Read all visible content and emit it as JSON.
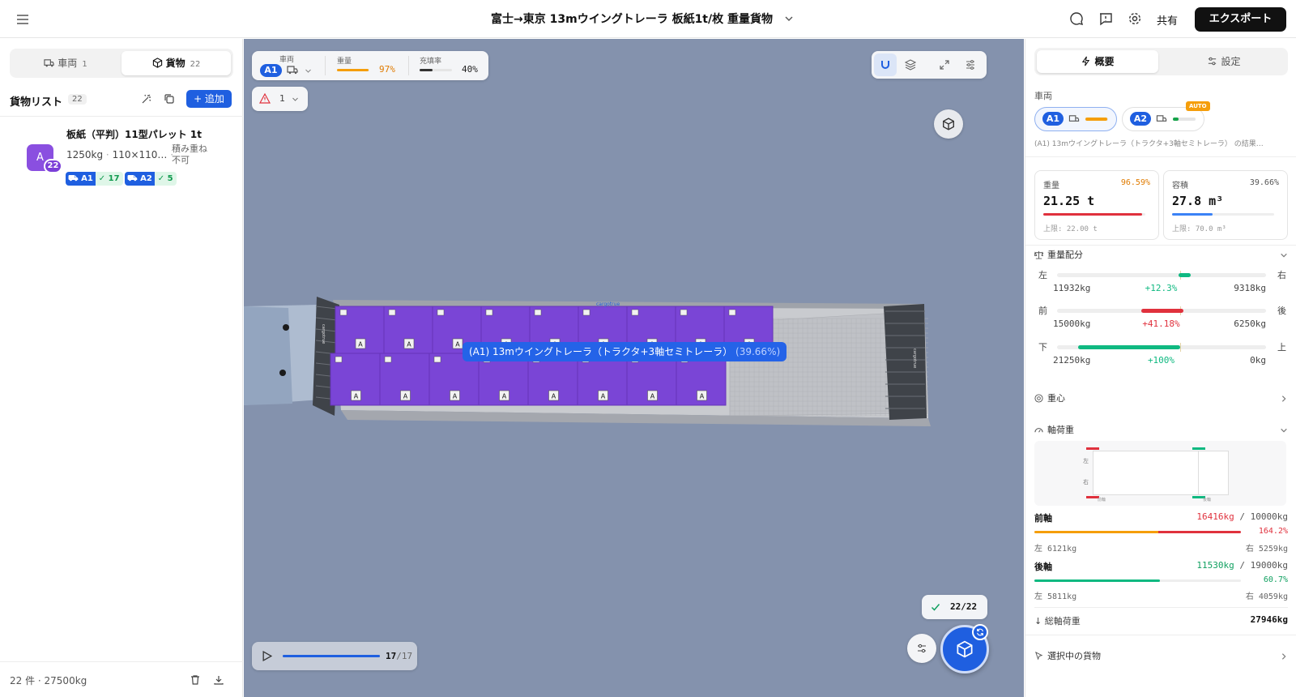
{
  "header": {
    "title": "富士→東京 13mウイングトレーラ 板紙1t/枚 重量貨物",
    "share": "共有",
    "export": "エクスポート",
    "icons": [
      "menu-icon",
      "chat-icon",
      "feedback-icon",
      "gear-icon"
    ]
  },
  "left": {
    "tabs": [
      {
        "label": "車両",
        "count": "1",
        "icon": "truck-icon"
      },
      {
        "label": "貨物",
        "count": "22",
        "icon": "box-icon",
        "active": true
      }
    ],
    "list_title": "貨物リスト",
    "list_count": "22",
    "add_label": "+ 追加",
    "items": [
      {
        "avatar": "A",
        "badge": "22",
        "name": "板紙（平判）11型パレット 1t",
        "weight": "1250kg",
        "size": "110×110…",
        "note": "積み重ね不可",
        "vehicles": [
          {
            "id": "A1",
            "count": "17"
          },
          {
            "id": "A2",
            "count": "5"
          }
        ]
      }
    ],
    "footer": "22 件 · 27500kg"
  },
  "viewer": {
    "stats": {
      "vehicle_label": "車両",
      "vehicle": "A1",
      "weight_label": "重量",
      "weight": "97%",
      "weight_value": 0.97,
      "fill_label": "充填率",
      "fill": "40%",
      "fill_value": 0.4
    },
    "warn_count": "1",
    "tooltip_name": "(A1) 13mウイングトレーラ（トラクタ+3軸セミトレーラ）",
    "tooltip_pct": "(39.66%)",
    "box_label": "A",
    "wall_label": "cargotrue",
    "playback": {
      "current": "17",
      "total": "/17",
      "progress": 1.0
    },
    "done": "22/22",
    "colors": {
      "cargo": "#7a45d6",
      "cargo_dark": "#6634b8",
      "bg": "#8492ad",
      "accent": "#1f5fe0"
    }
  },
  "right": {
    "tabs": [
      {
        "label": "概要",
        "icon": "spark-icon",
        "active": true
      },
      {
        "label": "設定",
        "icon": "sliders-icon"
      }
    ],
    "vehicle_label": "車両",
    "vehicles": [
      {
        "id": "A1",
        "fill": 0.97,
        "color": "#f59e0b"
      },
      {
        "id": "A2",
        "fill": 0.25,
        "color": "#16a34a",
        "badge": "AUTO"
      }
    ],
    "vehicle_desc": "(A1) 13mウイングトレーラ（トラクタ+3軸セミトレーラ） の結果…",
    "weight_card": {
      "label": "重量",
      "pct": "96.59%",
      "value": "21.25 t",
      "limit": "上限: 22.00 t",
      "fill": 0.9659,
      "color": "#e0313d"
    },
    "volume_card": {
      "label": "容積",
      "pct": "39.66%",
      "value": "27.8 m³",
      "limit": "上限: 70.0 m³",
      "fill": 0.3966,
      "color": "#3b82f6"
    },
    "dist_title": "重量配分",
    "dist": [
      {
        "l": "左",
        "r": "右",
        "lv": "11932kg",
        "mid": "+12.3%",
        "rv": "9318kg",
        "color": "#10b981",
        "offset": 0.123
      },
      {
        "l": "前",
        "r": "後",
        "lv": "15000kg",
        "mid": "+41.18%",
        "rv": "6250kg",
        "color": "#e0313d",
        "offset": -0.4118
      },
      {
        "l": "下",
        "r": "上",
        "lv": "21250kg",
        "mid": "+100%",
        "rv": "0kg",
        "color": "#10b981",
        "offset": -1.0
      }
    ],
    "cog_title": "重心",
    "axle_title": "軸荷重",
    "diagram": {
      "left": "左",
      "right": "右",
      "front": "前輪",
      "rear": "後輪"
    },
    "front_axle": {
      "label": "前軸",
      "load": "16416kg",
      "limit": "/ 10000kg",
      "pct": "164.2%",
      "left": "左 6121kg",
      "right": "右 5259kg",
      "fill": 1.0
    },
    "rear_axle": {
      "label": "後軸",
      "load": "11530kg",
      "limit": "/ 19000kg",
      "pct": "60.7%",
      "left": "左 5811kg",
      "right": "右 4059kg",
      "fill": 0.607
    },
    "total_label": "総軸荷重",
    "total": "27946kg",
    "selected_title": "選択中の貨物"
  }
}
